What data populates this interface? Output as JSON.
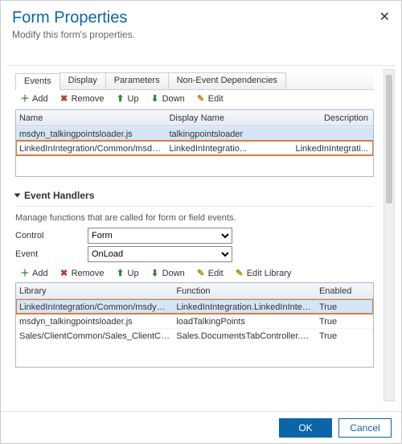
{
  "header": {
    "title": "Form Properties",
    "subtitle": "Modify this form's properties."
  },
  "tabs": [
    "Events",
    "Display",
    "Parameters",
    "Non-Event Dependencies"
  ],
  "toolbar1": {
    "add": "Add",
    "remove": "Remove",
    "up": "Up",
    "down": "Down",
    "edit": "Edit"
  },
  "libgrid": {
    "headers": {
      "name": "Name",
      "display": "Display Name",
      "desc": "Description"
    },
    "rows": [
      {
        "name": "msdyn_talkingpointsloader.js",
        "display": "talkingpointsloader",
        "desc": ""
      },
      {
        "name": "LinkedInIntegration/Common/msdyn_L...",
        "display": "LinkedInIntegratio...",
        "desc": "LinkedInIntegrati..."
      }
    ]
  },
  "handlers": {
    "title": "Event Handlers",
    "desc": "Manage functions that are called for form or field events.",
    "controlLabel": "Control",
    "eventLabel": "Event",
    "controlValue": "Form",
    "eventValue": "OnLoad"
  },
  "toolbar2": {
    "add": "Add",
    "remove": "Remove",
    "up": "Up",
    "down": "Down",
    "edit": "Edit",
    "editlib": "Edit Library"
  },
  "evgrid": {
    "headers": {
      "lib": "Library",
      "fn": "Function",
      "en": "Enabled"
    },
    "rows": [
      {
        "lib": "LinkedInIntegration/Common/msdyn_L...",
        "fn": "LinkedInIntegration.LinkedInIntegration...",
        "en": "True"
      },
      {
        "lib": "msdyn_talkingpointsloader.js",
        "fn": "loadTalkingPoints",
        "en": "True"
      },
      {
        "lib": "Sales/ClientCommon/Sales_ClientCom...",
        "fn": "Sales.DocumentsTabController.shouldS...",
        "en": "True"
      }
    ]
  },
  "footer": {
    "ok": "OK",
    "cancel": "Cancel"
  }
}
